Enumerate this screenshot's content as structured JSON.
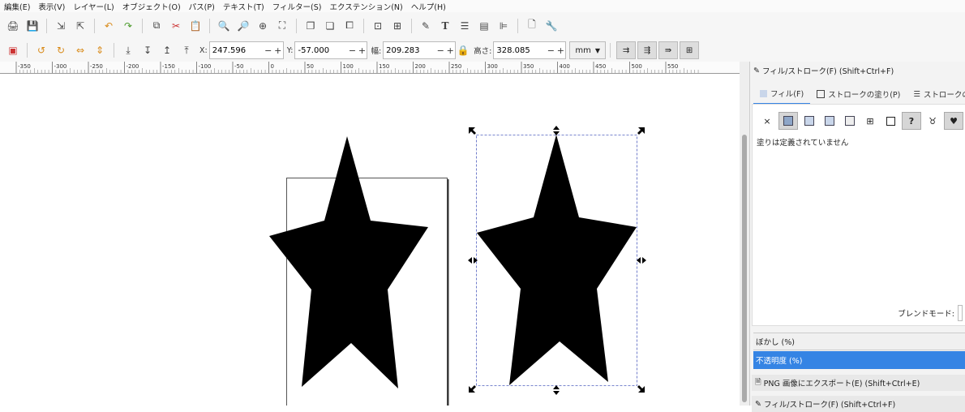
{
  "menu": [
    "編集(E)",
    "表示(V)",
    "レイヤー(L)",
    "オブジェクト(O)",
    "パス(P)",
    "テキスト(T)",
    "フィルター(S)",
    "エクステンション(N)",
    "ヘルプ(H)"
  ],
  "toolbar2": {
    "x_label": "X:",
    "x_value": "247.596",
    "y_label": "Y:",
    "y_value": "-57.000",
    "w_label": "幅:",
    "w_value": "209.283",
    "h_label": "高さ:",
    "h_value": "328.085",
    "unit": "mm",
    "minus": "−",
    "plus": "+"
  },
  "ruler_ticks": [
    "-350",
    "-300",
    "-250",
    "-200",
    "-150",
    "-100",
    "-50",
    "0",
    "50",
    "100",
    "150",
    "200",
    "250",
    "300",
    "350",
    "400",
    "450",
    "500",
    "550"
  ],
  "panel": {
    "title": "フィル/ストローク(F) (Shift+Ctrl+F)",
    "tabs": [
      "フィル(F)",
      "ストロークの塗り(P)",
      "ストロークの"
    ],
    "undefined_text": "塗りは定義されていません",
    "blend_label": "ブレンドモード:",
    "blur_label": "ぼかし (%)",
    "opacity_label": "不透明度 (%)",
    "dock_png": "PNG 画像にエクスポート(E) (Shift+Ctrl+E)",
    "dock_fill": "フィル/ストローク(F) (Shift+Ctrl+F)",
    "fill_none": "×",
    "fill_unset": "?"
  },
  "colors": {
    "accent": "#3584e4",
    "selection": "#4f5fbf"
  }
}
